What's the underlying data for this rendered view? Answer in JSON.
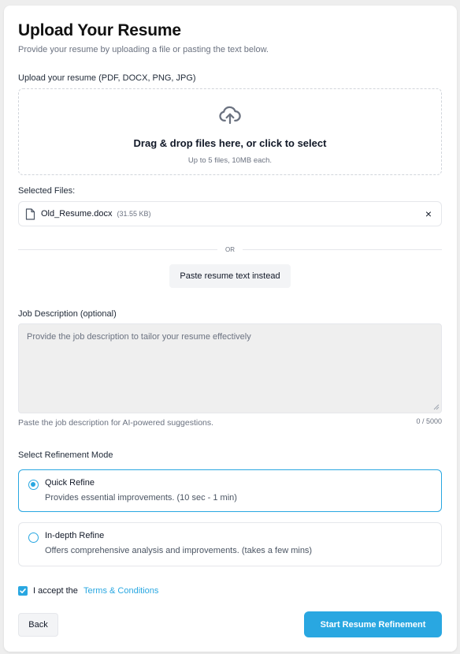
{
  "header": {
    "title": "Upload Your Resume",
    "subtitle": "Provide your resume by uploading a file or pasting the text below."
  },
  "upload": {
    "label": "Upload your resume (PDF, DOCX, PNG, JPG)",
    "dropzone_title": "Drag & drop files here, or click to select",
    "dropzone_hint": "Up to 5 files, 10MB each.",
    "icon": "cloud-upload-icon"
  },
  "selected_files": {
    "label": "Selected Files:",
    "files": [
      {
        "name": "Old_Resume.docx",
        "size": "(31.55 KB)",
        "icon": "file-icon"
      }
    ],
    "remove_symbol": "×"
  },
  "separator": {
    "text": "OR"
  },
  "paste_button": {
    "label": "Paste resume text instead"
  },
  "job_description": {
    "label": "Job Description (optional)",
    "value": "",
    "placeholder": "Provide the job description to tailor your resume effectively",
    "hint": "Paste the job description for AI-powered suggestions.",
    "counter": "0 / 5000"
  },
  "refinement": {
    "label": "Select Refinement Mode",
    "options": [
      {
        "title": "Quick Refine",
        "description": "Provides essential improvements. (10 sec - 1 min)",
        "selected": true
      },
      {
        "title": "In-depth Refine",
        "description": "Offers comprehensive analysis and improvements. (takes a few mins)",
        "selected": false
      }
    ]
  },
  "terms": {
    "accepted": true,
    "prefix": "I accept the",
    "link_text": "Terms & Conditions"
  },
  "footer": {
    "back_label": "Back",
    "start_label": "Start Resume Refinement"
  },
  "colors": {
    "accent": "#29a7e1",
    "background": "#eeeeee",
    "card": "#ffffff",
    "text": "#111827",
    "muted": "#6b7280"
  }
}
